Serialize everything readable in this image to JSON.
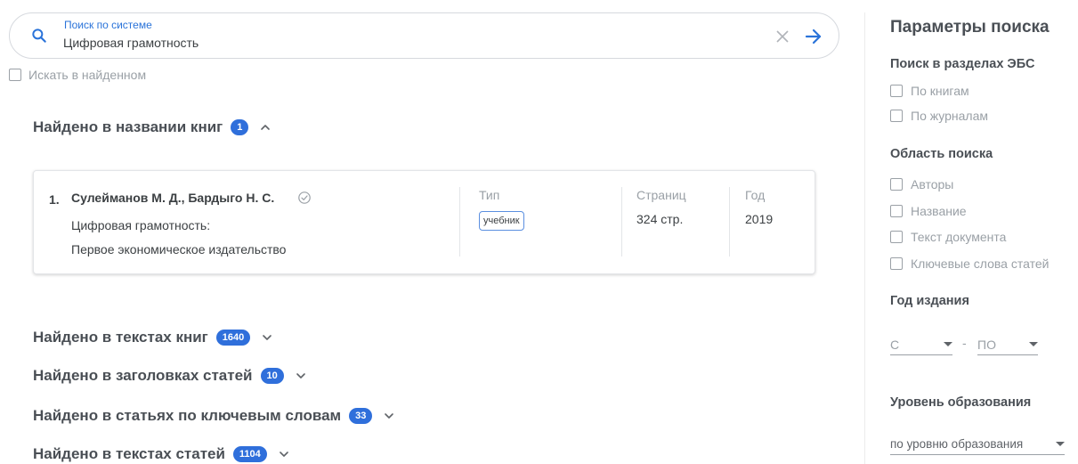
{
  "search": {
    "label": "Поиск по системе",
    "value": "Цифровая грамотность",
    "refine_label": "Искать в найденном"
  },
  "sections": [
    {
      "title": "Найдено в названии книг",
      "count": "1",
      "expanded": true
    },
    {
      "title": "Найдено в текстах книг",
      "count": "1640",
      "expanded": false
    },
    {
      "title": "Найдено в заголовках статей",
      "count": "10",
      "expanded": false
    },
    {
      "title": "Найдено в статьях по ключевым словам",
      "count": "33",
      "expanded": false
    },
    {
      "title": "Найдено в текстах статей",
      "count": "1104",
      "expanded": false
    }
  ],
  "result": {
    "number": "1.",
    "authors": "Сулейманов М. Д., Бардыго Н. С.",
    "title": "Цифровая грамотность:",
    "publisher": "Первое экономическое издательство",
    "type_header": "Тип",
    "type_value": "учебник",
    "pages_header": "Страниц",
    "pages_value": "324 стр.",
    "year_header": "Год",
    "year_value": "2019"
  },
  "sidebar": {
    "title": "Параметры поиска",
    "sections_heading": "Поиск в разделах ЭБС",
    "sections_options": [
      "По книгам",
      "По журналам"
    ],
    "area_heading": "Область поиска",
    "area_options": [
      "Авторы",
      "Название",
      "Текст документа",
      "Ключевые слова статей"
    ],
    "year_heading": "Год издания",
    "year_from": "С",
    "year_dash": "-",
    "year_to": "ПО",
    "edu_heading": "Уровень образования",
    "edu_select": "по уровню образования"
  },
  "colors": {
    "accent": "#2f6fdb",
    "link": "#2a73d9",
    "muted": "#9aa0a6"
  },
  "icons": {
    "search": "search-icon",
    "clear": "close-icon",
    "submit": "arrow-right-icon",
    "verified": "check-circle-icon",
    "expand": "chevron-down-icon",
    "collapse": "chevron-up-icon"
  }
}
